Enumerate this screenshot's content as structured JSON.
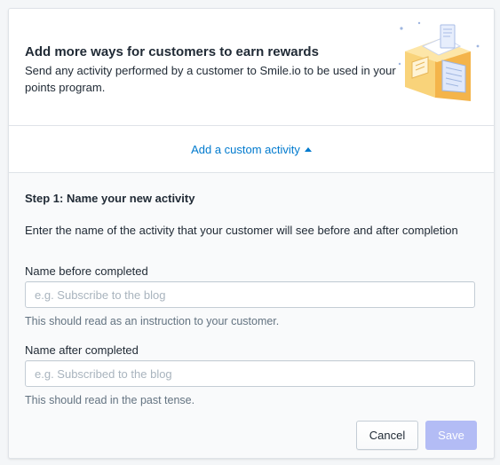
{
  "header": {
    "title": "Add more ways for customers to earn rewards",
    "description": "Send any activity performed by a customer to Smile.io to be used in your points program."
  },
  "toggle": {
    "label": "Add a custom activity",
    "icon": "caret-up-icon"
  },
  "form": {
    "step_title": "Step 1: Name your new activity",
    "step_description": "Enter the name of the activity that your customer will see before and after completion",
    "fields": [
      {
        "label": "Name before completed",
        "value": "",
        "placeholder": "e.g. Subscribe to the blog",
        "help": "This should read as an instruction to your customer."
      },
      {
        "label": "Name after completed",
        "value": "",
        "placeholder": "e.g. Subscribed to the blog",
        "help": "This should read in the past tense."
      }
    ],
    "cancel_label": "Cancel",
    "save_label": "Save",
    "save_disabled": true
  },
  "colors": {
    "link": "#007ace",
    "save_disabled": "#b3bcf5",
    "help_text": "#637381"
  }
}
